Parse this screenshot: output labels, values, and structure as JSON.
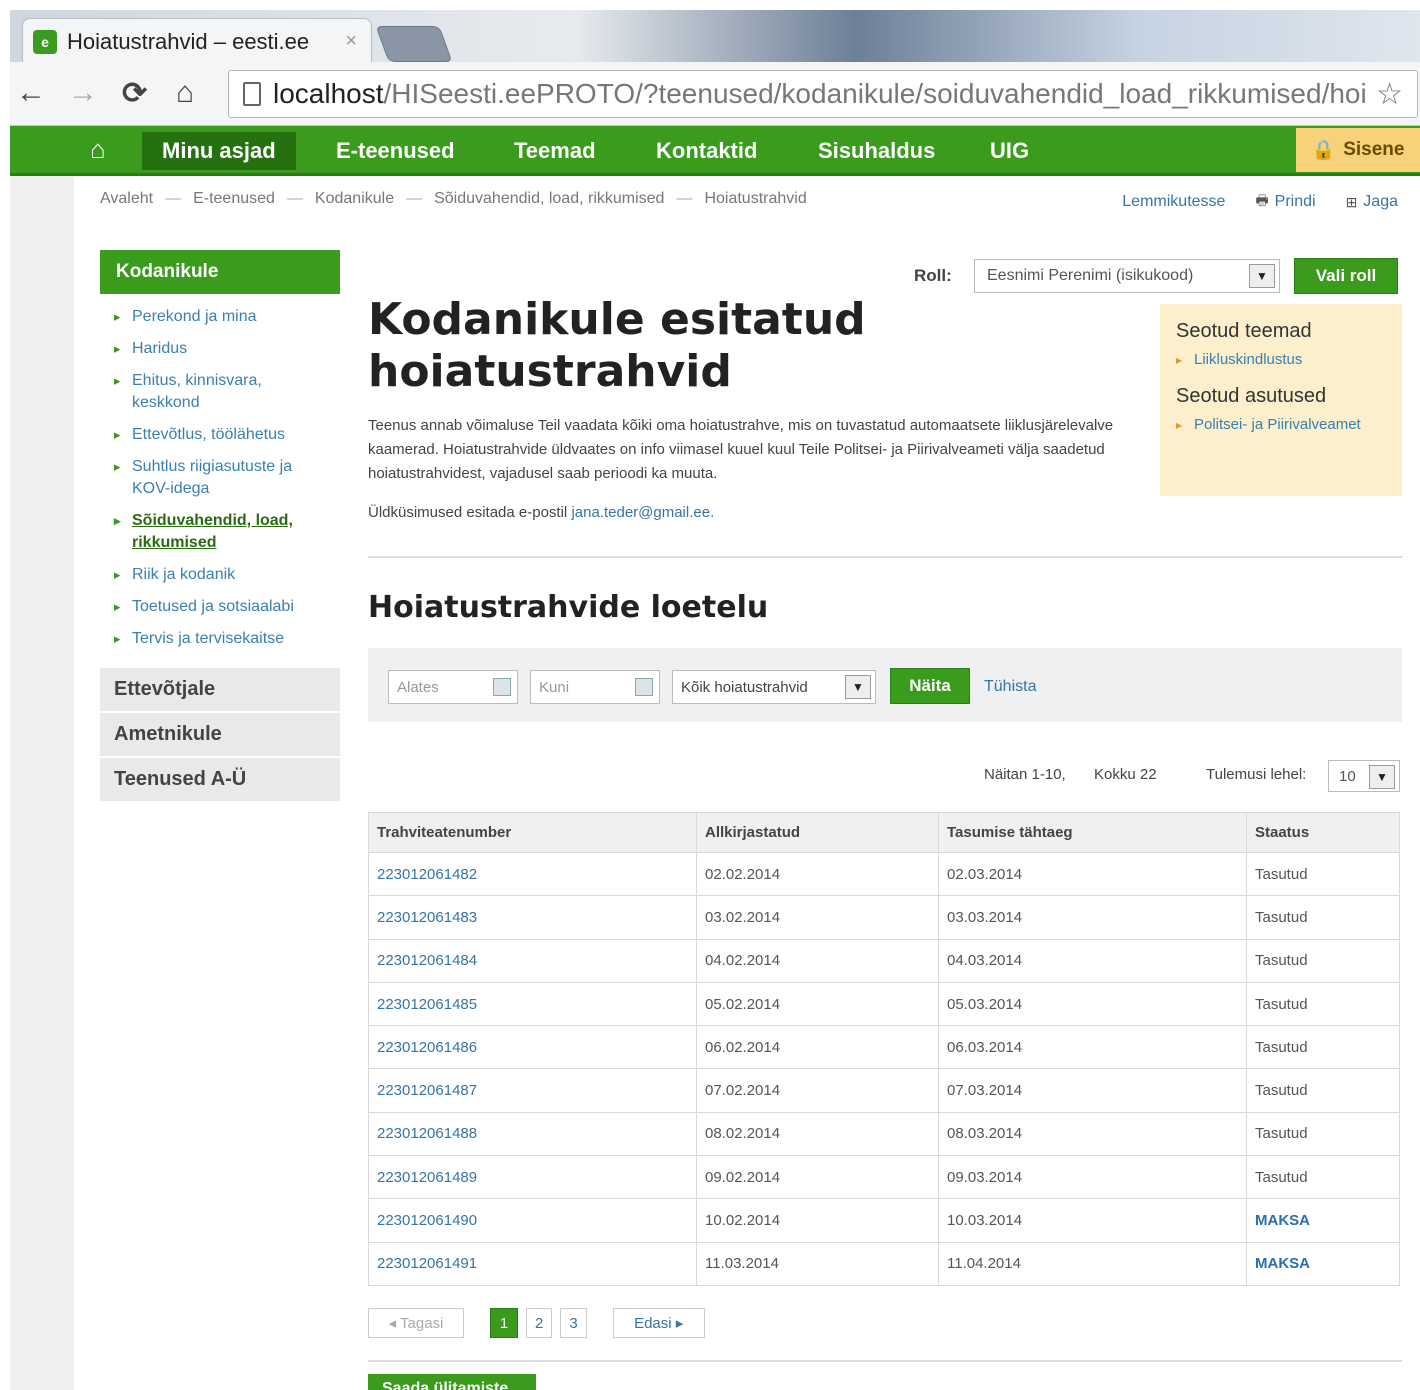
{
  "browser": {
    "tab_title": "Hoiatustrahvid – eesti.ee",
    "tab_close": "×",
    "url_host": "localhost",
    "url_path": "/HISeesti.eePROTO/?teenused/kodanikule/soiduvahendid_load_rikkumised/hoi"
  },
  "nav": {
    "items": [
      "Minu asjad",
      "E-teenused",
      "Teemad",
      "Kontaktid",
      "Sisuhaldus",
      "UIG"
    ],
    "signin": "Sisene"
  },
  "breadcrumb": [
    "Avaleht",
    "E-teenused",
    "Kodanikule",
    "Sõiduvahendid, load, rikkumised",
    "Hoiatustrahvid"
  ],
  "breadcrumb_sep": "—",
  "tools": {
    "favorite": "Lemmikutesse",
    "print": "Prindi",
    "share": "Jaga"
  },
  "sidebar": {
    "heading": "Kodanikule",
    "items": [
      "Perekond ja mina",
      "Haridus",
      "Ehitus, kinnisvara, keskkond",
      "Ettevõtlus, töölähetus",
      "Suhtlus riigiasutuste ja KOV-idega",
      "Sõiduvahendid, load, rikkumised",
      "Riik ja kodanik",
      "Toetused ja sotsiaalabi",
      "Tervis ja tervisekaitse"
    ],
    "categories": [
      "Ettevõtjale",
      "Ametnikule",
      "Teenused A-Ü"
    ]
  },
  "role": {
    "label": "Roll:",
    "value": "Eesnimi Perenimi (isikukood)",
    "button": "Vali roll"
  },
  "main": {
    "title": "Kodanikule esitatud hoiatustrahvid",
    "intro": "Teenus annab võimaluse Teil vaadata kõiki oma hoiatustrahve, mis on tuvastatud automaatsete liiklusjärelevalve kaamerad. Hoiatustrahvide üldvaates on info viimasel kuuel kuul Teile Politsei- ja Piirivalveameti välja saadetud hoiatustrahvidest, vajadusel saab perioodi ka muuta.",
    "contact_prefix": "Üldküsimused esitada e-postil",
    "contact_email": "jana.teder@gmail.ee.",
    "section_title": "Hoiatustrahvide loetelu"
  },
  "related": {
    "topics_heading": "Seotud teemad",
    "topics": [
      "Liikluskindlustus"
    ],
    "agencies_heading": "Seotud asutused",
    "agencies": [
      "Politsei- ja Piirivalveamet"
    ]
  },
  "filter": {
    "from_placeholder": "Alates",
    "to_placeholder": "Kuni",
    "type_value": "Kõik hoiatustrahvid",
    "show_button": "Näita",
    "clear_link": "Tühista"
  },
  "results": {
    "showing": "Näitan 1-10,",
    "total": "Kokku 22",
    "per_page_label": "Tulemusi lehel:",
    "per_page_value": "10"
  },
  "table": {
    "headers": [
      "Trahviteatenumber",
      "Allkirjastatud",
      "Tasumise tähtaeg",
      "Staatus"
    ],
    "rows": [
      [
        "223012061482",
        "02.02.2014",
        "02.03.2014",
        "Tasutud"
      ],
      [
        "223012061483",
        "03.02.2014",
        "03.03.2014",
        "Tasutud"
      ],
      [
        "223012061484",
        "04.02.2014",
        "04.03.2014",
        "Tasutud"
      ],
      [
        "223012061485",
        "05.02.2014",
        "05.03.2014",
        "Tasutud"
      ],
      [
        "223012061486",
        "06.02.2014",
        "06.03.2014",
        "Tasutud"
      ],
      [
        "223012061487",
        "07.02.2014",
        "07.03.2014",
        "Tasutud"
      ],
      [
        "223012061488",
        "08.02.2014",
        "08.03.2014",
        "Tasutud"
      ],
      [
        "223012061489",
        "09.02.2014",
        "09.03.2014",
        "Tasutud"
      ],
      [
        "223012061490",
        "10.02.2014",
        "10.03.2014",
        "MAKSA"
      ],
      [
        "223012061491",
        "11.03.2014",
        "11.04.2014",
        "MAKSA"
      ]
    ]
  },
  "pager": {
    "prev": "◂ Tagasi",
    "pages": [
      "1",
      "2",
      "3"
    ],
    "current": "1",
    "next": "Edasi ▸"
  },
  "bottom_button": "Saada ülitamiste"
}
